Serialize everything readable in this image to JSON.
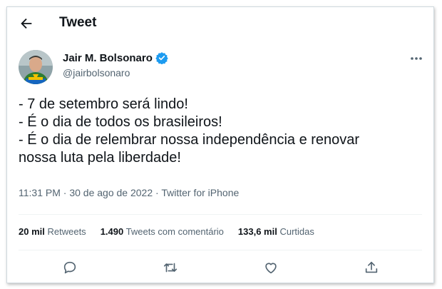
{
  "header": {
    "title": "Tweet",
    "back_icon": "arrow-left-icon"
  },
  "author": {
    "name": "Jair M. Bolsonaro",
    "handle": "@jairbolsonaro",
    "verified": true,
    "verified_icon": "verified-badge-icon"
  },
  "tweet": {
    "lines": [
      "- 7 de setembro será lindo!",
      "- É o dia de todos os brasileiros!",
      "- É o dia de relembrar nossa independência e renovar",
      "nossa luta pela liberdade!"
    ]
  },
  "meta": {
    "time": "11:31 PM",
    "separator": "·",
    "date": "30 de ago de 2022",
    "source": "Twitter for iPhone"
  },
  "stats": [
    {
      "count": "20 mil",
      "label": "Retweets"
    },
    {
      "count": "1.490",
      "label": "Tweets com comentário"
    },
    {
      "count": "133,6 mil",
      "label": "Curtidas"
    }
  ],
  "actions": [
    "reply-icon",
    "retweet-icon",
    "like-icon",
    "share-icon"
  ],
  "colors": {
    "text": "#0f1419",
    "secondary": "#536471",
    "verified": "#1d9bf0",
    "divider": "#eff3f4",
    "border": "#cfd9de"
  }
}
